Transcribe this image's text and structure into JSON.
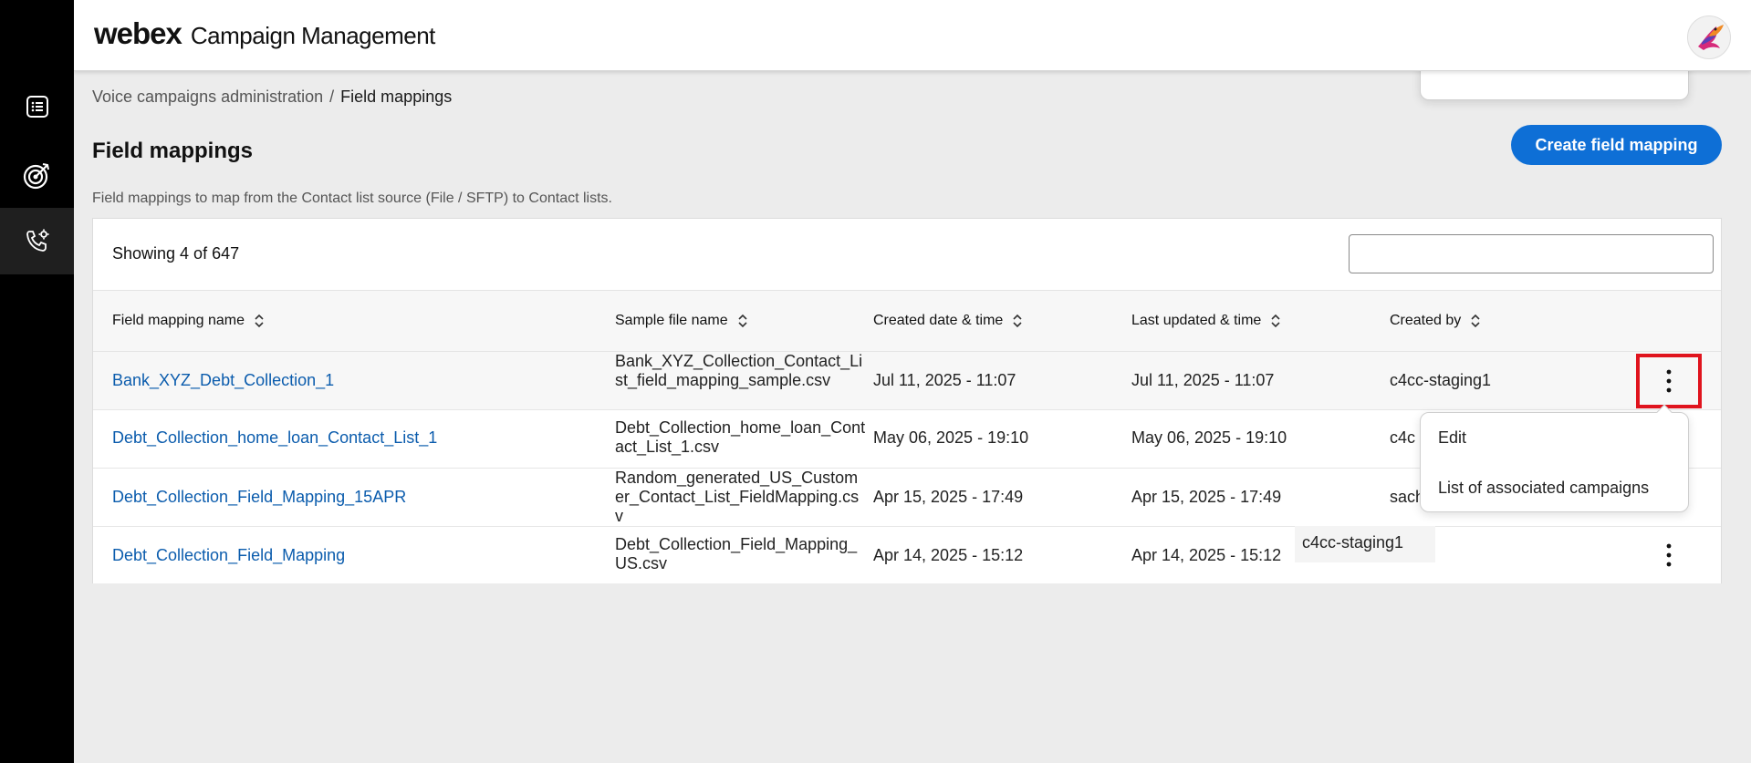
{
  "header": {
    "brand": "webex",
    "title": "Campaign Management"
  },
  "breadcrumb": {
    "parent": "Voice campaigns administration",
    "separator": "/",
    "current": "Field mappings"
  },
  "page": {
    "title": "Field mappings",
    "description": "Field mappings to map from the Contact list source (File / SFTP) to Contact lists.",
    "create_button": "Create field mapping"
  },
  "table": {
    "showing": "Showing 4 of 647",
    "search_value": "",
    "columns": [
      "Field mapping name",
      "Sample file name",
      "Created date & time",
      "Last updated & time",
      "Created by"
    ],
    "rows": [
      {
        "name": "Bank_XYZ_Debt_Collection_1",
        "file": "Bank_XYZ_Collection_Contact_List_field_mapping_sample.csv",
        "created": "Jul 11, 2025 - 11:07",
        "updated": "Jul 11, 2025 - 11:07",
        "created_by": "c4cc-staging1"
      },
      {
        "name": "Debt_Collection_home_loan_Contact_List_1",
        "file": "Debt_Collection_home_loan_Contact_List_1.csv",
        "created": "May 06, 2025 - 19:10",
        "updated": "May 06, 2025 - 19:10",
        "created_by": "c4c"
      },
      {
        "name": "Debt_Collection_Field_Mapping_15APR",
        "file": "Random_generated_US_Customer_Contact_List_FieldMapping.csv",
        "created": "Apr 15, 2025 - 17:49",
        "updated": "Apr 15, 2025 - 17:49",
        "created_by": "sach"
      },
      {
        "name": "Debt_Collection_Field_Mapping",
        "file": "Debt_Collection_Field_Mapping_US.csv",
        "created": "Apr 14, 2025 - 15:12",
        "updated": "Apr 14, 2025 - 15:12",
        "created_by": ""
      }
    ],
    "tooltip_created_by": "c4cc-staging1"
  },
  "row_menu": {
    "items": [
      "Edit",
      "List of associated campaigns"
    ]
  },
  "colors": {
    "accent": "#0e6fd6",
    "link": "#0b5cad",
    "highlight": "#e0141e"
  }
}
